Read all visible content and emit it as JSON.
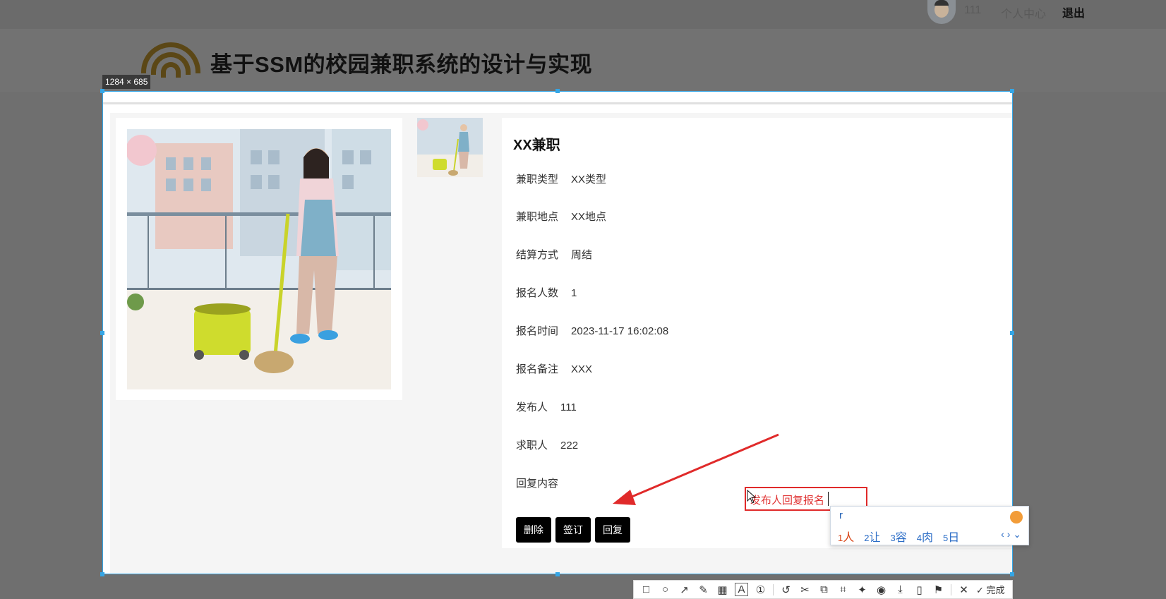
{
  "top_bar": {
    "username": "111",
    "personal_center": "个人中心",
    "logout": "退出"
  },
  "header": {
    "site_title": "基于SSM的校园兼职系统的设计与实现"
  },
  "capture": {
    "size_label": "1284 × 685"
  },
  "detail": {
    "title": "XX兼职",
    "fields": [
      {
        "label": "兼职类型",
        "value": "XX类型"
      },
      {
        "label": "兼职地点",
        "value": "XX地点"
      },
      {
        "label": "结算方式",
        "value": "周结"
      },
      {
        "label": "报名人数",
        "value": "1"
      },
      {
        "label": "报名时间",
        "value": "2023-11-17 16:02:08"
      },
      {
        "label": "报名备注",
        "value": "XXX"
      },
      {
        "label": "发布人",
        "value": "111"
      },
      {
        "label": "求职人",
        "value": "222"
      },
      {
        "label": "回复内容",
        "value": ""
      }
    ],
    "buttons": {
      "delete": "删除",
      "sign": "签订",
      "reply": "回复"
    }
  },
  "annotation": {
    "text": "发布人回复报名",
    "color": "#e02a2a"
  },
  "ime": {
    "input": "r",
    "candidates": [
      {
        "index": "1",
        "text": "人"
      },
      {
        "index": "2",
        "text": "让"
      },
      {
        "index": "3",
        "text": "容"
      },
      {
        "index": "4",
        "text": "肉"
      },
      {
        "index": "5",
        "text": "日"
      }
    ]
  },
  "toolbar": {
    "icons": [
      "rectangle-icon",
      "ellipse-icon",
      "arrow-icon",
      "pen-icon",
      "mosaic-icon",
      "text-icon",
      "number-icon",
      "undo-icon",
      "cut-icon",
      "copy-icon",
      "ocr-icon",
      "pin-icon",
      "record-icon",
      "download-icon",
      "long-screenshot-icon",
      "bookmark-icon",
      "close-icon"
    ],
    "done_label": "完成"
  },
  "colors": {
    "selection_border": "#35a6e6",
    "button_bg": "#000000",
    "annotation_red": "#e02a2a"
  }
}
